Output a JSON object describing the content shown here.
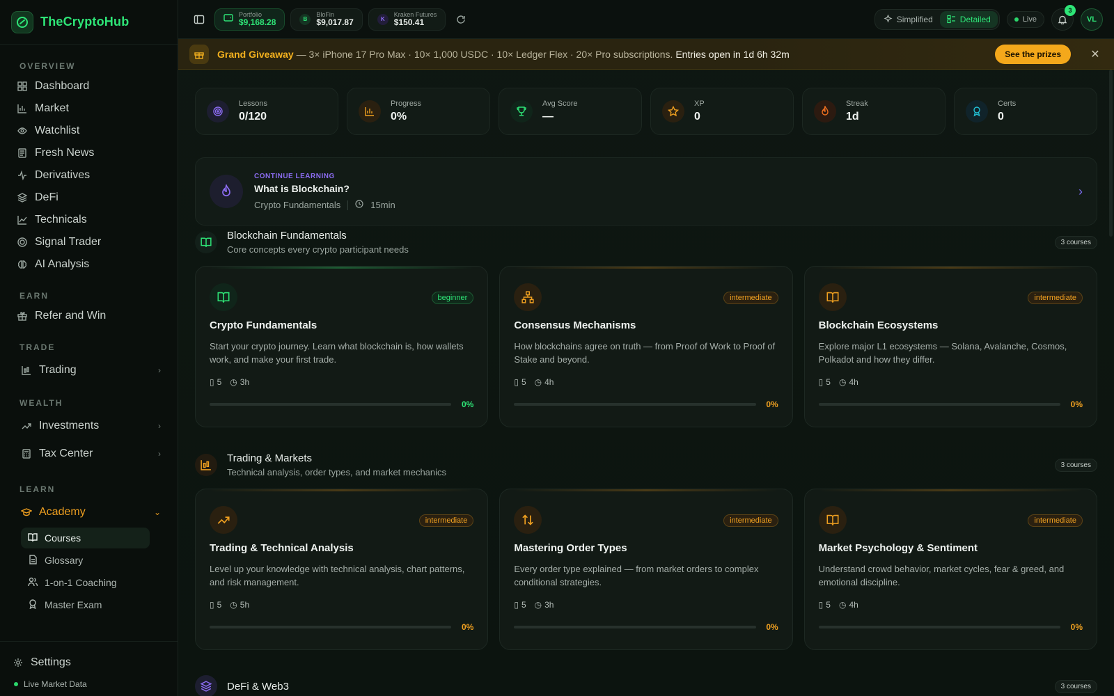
{
  "brand": {
    "name": "TheCryptoHub",
    "accent": "#2ee577"
  },
  "sidebar": {
    "overview_label": "OVERVIEW",
    "overview": [
      {
        "label": "Dashboard",
        "icon": "grid-icon"
      },
      {
        "label": "Market",
        "icon": "bar-chart-icon"
      },
      {
        "label": "Watchlist",
        "icon": "eye-icon"
      },
      {
        "label": "Fresh News",
        "icon": "newspaper-icon"
      },
      {
        "label": "Derivatives",
        "icon": "activity-icon"
      },
      {
        "label": "DeFi",
        "icon": "layers-icon"
      },
      {
        "label": "Technicals",
        "icon": "line-chart-icon"
      },
      {
        "label": "Signal Trader",
        "icon": "target-icon"
      },
      {
        "label": "AI Analysis",
        "icon": "brain-icon"
      }
    ],
    "earn_label": "EARN",
    "earn": [
      {
        "label": "Refer and Win",
        "icon": "gift-icon"
      }
    ],
    "trade_label": "TRADE",
    "trade": [
      {
        "label": "Trading",
        "icon": "candles-icon"
      }
    ],
    "wealth_label": "WEALTH",
    "wealth": [
      {
        "label": "Investments",
        "icon": "trend-icon"
      },
      {
        "label": "Tax Center",
        "icon": "calculator-icon"
      }
    ],
    "learn_label": "LEARN",
    "academy": "Academy",
    "academy_sub": [
      {
        "label": "Courses",
        "icon": "book-icon"
      },
      {
        "label": "Glossary",
        "icon": "document-icon"
      },
      {
        "label": "1-on-1 Coaching",
        "icon": "users-icon"
      },
      {
        "label": "Master Exam",
        "icon": "award-icon"
      }
    ],
    "settings": "Settings",
    "live_data": "Live Market Data"
  },
  "topbar": {
    "portfolio_label": "Portfolio",
    "portfolio_value": "$9,168.28",
    "blofin_label": "BloFin",
    "blofin_value": "$9,017.87",
    "blofin_initial": "B",
    "kraken_label": "Kraken Futures",
    "kraken_value": "$150.41",
    "kraken_initial": "K",
    "simplified": "Simplified",
    "detailed": "Detailed",
    "live": "Live",
    "notifications": "3",
    "user_initials": "VL"
  },
  "banner": {
    "title": "Grand Giveaway",
    "description": " — 3× iPhone 17 Pro Max · 10× 1,000 USDC · 10× Ledger Flex · 20× Pro subscriptions.",
    "entries": "Entries open in 1d 6h 32m",
    "cta": "See the prizes",
    "accent": "#f4a81b"
  },
  "stats": [
    {
      "label": "Lessons",
      "value": "0/120",
      "icon": "target-icon",
      "color": "#8b6cf0"
    },
    {
      "label": "Progress",
      "value": "0%",
      "icon": "bar-chart-icon",
      "color": "#f0a020"
    },
    {
      "label": "Avg Score",
      "value": "—",
      "icon": "trophy-icon",
      "color": "#2ee577"
    },
    {
      "label": "XP",
      "value": "0",
      "icon": "star-icon",
      "color": "#f0a020"
    },
    {
      "label": "Streak",
      "value": "1d",
      "icon": "flame-icon",
      "color": "#f07020"
    },
    {
      "label": "Certs",
      "value": "0",
      "icon": "award-icon",
      "color": "#22c1d6"
    }
  ],
  "continue": {
    "tag": "CONTINUE LEARNING",
    "title": "What is Blockchain?",
    "course": "Crypto Fundamentals",
    "duration": "15min"
  },
  "sections": [
    {
      "title": "Blockchain Fundamentals",
      "subtitle": "Core concepts every crypto participant needs",
      "count": "3 courses",
      "courses": [
        {
          "title": "Crypto Fundamentals",
          "level": "beginner",
          "desc": "Start your crypto journey. Learn what blockchain is, how wallets work, and make your first trade.",
          "lessons": "5",
          "hours": "3h",
          "progress": "0%"
        },
        {
          "title": "Consensus Mechanisms",
          "level": "intermediate",
          "desc": "How blockchains agree on truth — from Proof of Work to Proof of Stake and beyond.",
          "lessons": "5",
          "hours": "4h",
          "progress": "0%"
        },
        {
          "title": "Blockchain Ecosystems",
          "level": "intermediate",
          "desc": "Explore major L1 ecosystems — Solana, Avalanche, Cosmos, Polkadot and how they differ.",
          "lessons": "5",
          "hours": "4h",
          "progress": "0%"
        }
      ]
    },
    {
      "title": "Trading & Markets",
      "subtitle": "Technical analysis, order types, and market mechanics",
      "count": "3 courses",
      "courses": [
        {
          "title": "Trading & Technical Analysis",
          "level": "intermediate",
          "desc": "Level up your knowledge with technical analysis, chart patterns, and risk management.",
          "lessons": "5",
          "hours": "5h",
          "progress": "0%"
        },
        {
          "title": "Mastering Order Types",
          "level": "intermediate",
          "desc": "Every order type explained — from market orders to complex conditional strategies.",
          "lessons": "5",
          "hours": "3h",
          "progress": "0%"
        },
        {
          "title": "Market Psychology & Sentiment",
          "level": "intermediate",
          "desc": "Understand crowd behavior, market cycles, fear & greed, and emotional discipline.",
          "lessons": "5",
          "hours": "4h",
          "progress": "0%"
        }
      ]
    },
    {
      "title": "DeFi & Web3",
      "count": "3 courses"
    }
  ]
}
